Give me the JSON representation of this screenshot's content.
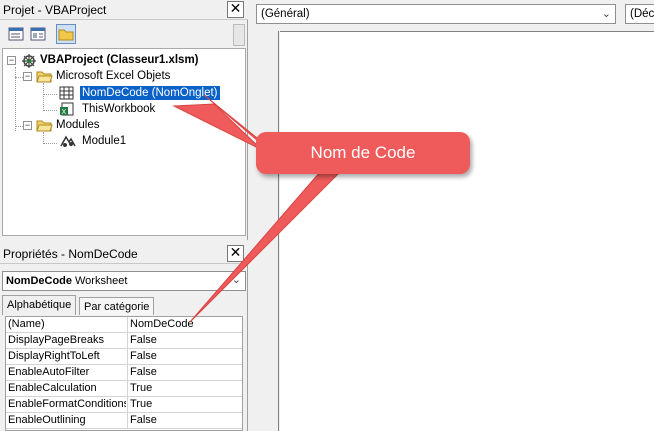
{
  "project_pane": {
    "title": "Projet - VBAProject",
    "close": "✕",
    "tree": {
      "project": "VBAProject (Classeur1.xlsm)",
      "excel_objects_folder": "Microsoft Excel Objets",
      "sheet_item": "NomDeCode (NomOnglet)",
      "workbook_item": "ThisWorkbook",
      "modules_folder": "Modules",
      "module_item": "Module1"
    }
  },
  "properties_pane": {
    "title": "Propriétés - NomDeCode",
    "close": "✕",
    "object_name": "NomDeCode",
    "object_type": "Worksheet",
    "tabs": [
      "Alphabétique",
      "Par catégorie"
    ],
    "rows": [
      {
        "key": "(Name)",
        "value": "NomDeCode"
      },
      {
        "key": "DisplayPageBreaks",
        "value": "False"
      },
      {
        "key": "DisplayRightToLeft",
        "value": "False"
      },
      {
        "key": "EnableAutoFilter",
        "value": "False"
      },
      {
        "key": "EnableCalculation",
        "value": "True"
      },
      {
        "key": "EnableFormatConditionsCalculation",
        "value": "True"
      },
      {
        "key": "EnableOutlining",
        "value": "False"
      }
    ]
  },
  "code_window": {
    "object_combo": "(Général)",
    "proc_combo": "(Déclarations)"
  },
  "callout": {
    "text": "Nom de Code",
    "color": "#ef5b5b"
  },
  "colors": {
    "selection": "#0a62c9"
  }
}
